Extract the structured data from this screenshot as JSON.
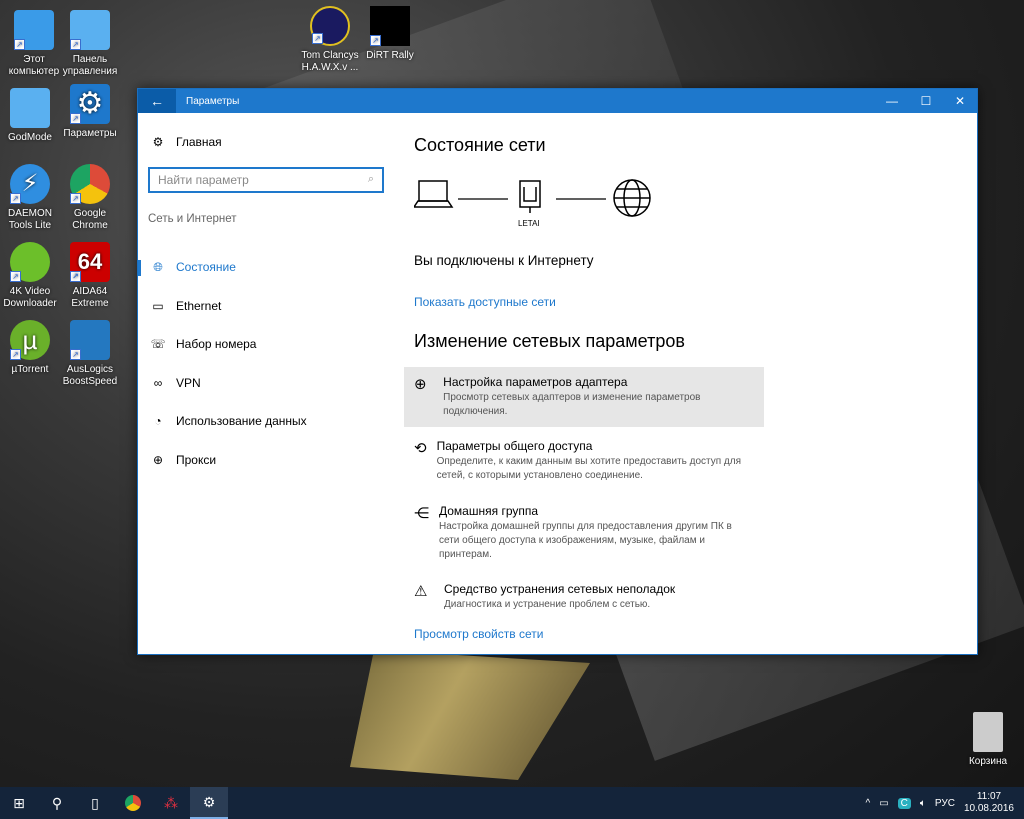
{
  "desktop": {
    "icons": [
      {
        "label": "Этот компьютер",
        "color": "#3a9be8"
      },
      {
        "label": "Панель управления",
        "color": "#3a9be8"
      },
      {
        "label": "GodMode",
        "color": "#3a9be8"
      },
      {
        "label": "Параметры",
        "color": "#1e78cc"
      },
      {
        "label": "DAEMON Tools Lite",
        "color": "#2f8ee0"
      },
      {
        "label": "Google Chrome",
        "color": "#dd4b39"
      },
      {
        "label": "4K Video Downloader",
        "color": "#6cbf2a"
      },
      {
        "label": "AIDA64 Extreme",
        "color": "#c00"
      },
      {
        "label": "µTorrent",
        "color": "#6ab02a"
      },
      {
        "label": "AusLogics BoostSpeed",
        "color": "#2478c0"
      },
      {
        "label": "Tom Clancys H.A.W.X.v ...",
        "color": "#1a1a60"
      },
      {
        "label": "DiRT Rally",
        "color": "#000"
      },
      {
        "label": "Корзина",
        "color": "#bbb"
      }
    ]
  },
  "window": {
    "title": "Параметры",
    "accent": "#1e78cc"
  },
  "left": {
    "home": "Главная",
    "search_placeholder": "Найти параметр",
    "category": "Сеть и Интернет",
    "nav": [
      {
        "label": "Состояние",
        "icon": "globe-icon"
      },
      {
        "label": "Ethernet",
        "icon": "ethernet-icon"
      },
      {
        "label": "Набор номера",
        "icon": "dialup-icon"
      },
      {
        "label": "VPN",
        "icon": "vpn-icon"
      },
      {
        "label": "Использование данных",
        "icon": "data-usage-icon"
      },
      {
        "label": "Прокси",
        "icon": "globe-icon"
      }
    ]
  },
  "main": {
    "title": "Состояние сети",
    "router_label": "LETAI",
    "connected": "Вы подключены к Интернету",
    "show_networks": "Показать доступные сети",
    "section": "Изменение сетевых параметров",
    "options": [
      {
        "title": "Настройка параметров адаптера",
        "desc": "Просмотр сетевых адаптеров и изменение параметров подключения."
      },
      {
        "title": "Параметры общего доступа",
        "desc": "Определите, к каким данным вы хотите предоставить доступ для сетей, с которыми установлено соединение."
      },
      {
        "title": "Домашняя группа",
        "desc": "Настройка домашней группы для предоставления другим ПК в сети общего доступа к изображениям, музыке, файлам и принтерам."
      },
      {
        "title": "Средство устранения сетевых неполадок",
        "desc": "Диагностика и устранение проблем с сетью."
      }
    ],
    "view_props": "Просмотр свойств сети"
  },
  "taskbar": {
    "lang": "РУС",
    "time": "11:07",
    "date": "10.08.2016"
  }
}
